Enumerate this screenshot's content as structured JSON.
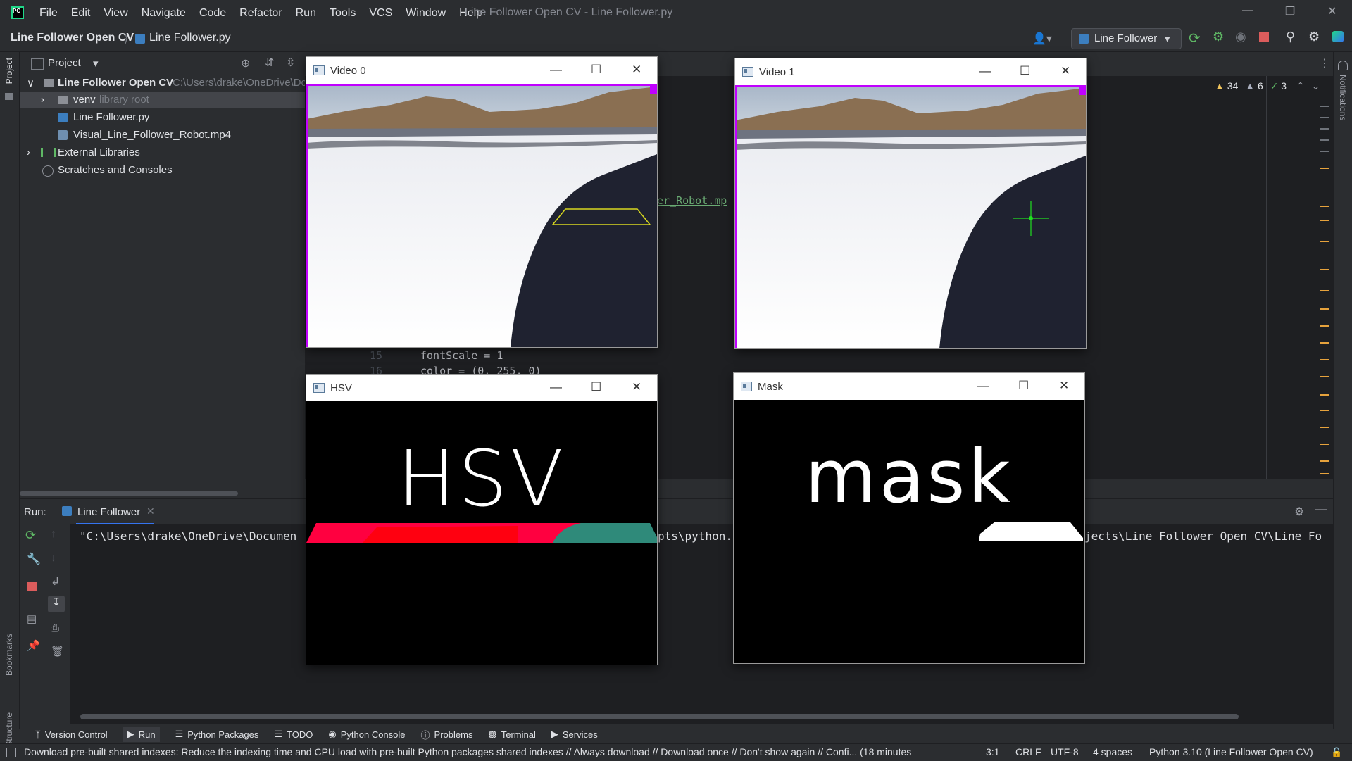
{
  "menu": [
    "File",
    "Edit",
    "View",
    "Navigate",
    "Code",
    "Refactor",
    "Run",
    "Tools",
    "VCS",
    "Window",
    "Help"
  ],
  "window_title": "Line Follower Open CV - Line Follower.py",
  "breadcrumb": {
    "project": "Line Follower Open CV",
    "file": "Line Follower.py"
  },
  "run_config": "Line Follower",
  "project_panel": {
    "title": "Project",
    "root": "Line Follower Open CV",
    "root_path": "C:\\Users\\drake\\OneDrive\\Dc",
    "items": [
      {
        "label": "venv",
        "hint": "library root"
      },
      {
        "label": "Line Follower.py"
      },
      {
        "label": "Visual_Line_Follower_Robot.mp4"
      }
    ],
    "external": "External Libraries",
    "scratches": "Scratches and Consoles"
  },
  "inspections": {
    "warnings": "34",
    "weak": "6",
    "ok": "3"
  },
  "editor": {
    "line_15_no": "15",
    "line_15_code": "fontScale = 1",
    "line_16_no": "16",
    "line_16_code": "color = (0, 255, 0)",
    "fragment": "er_Robot.mp"
  },
  "run_panel": {
    "label": "Run:",
    "tab": "Line Follower",
    "console_left": "\"C:\\Users\\drake\\OneDrive\\Documen",
    "console_mid": "pts\\python.",
    "console_right": "jects\\Line Follower Open CV\\Line Fo"
  },
  "cv_windows": [
    {
      "title": "Video 0"
    },
    {
      "title": "Video 1"
    },
    {
      "title": "HSV",
      "overlay": "HSV"
    },
    {
      "title": "Mask",
      "overlay": "mask"
    }
  ],
  "tool_windows": [
    "Version Control",
    "Run",
    "Python Packages",
    "TODO",
    "Python Console",
    "Problems",
    "Terminal",
    "Services"
  ],
  "left_strip": {
    "project": "Project",
    "bookmarks": "Bookmarks",
    "structure": "Structure"
  },
  "right_strip": {
    "notifications": "Notifications"
  },
  "status": {
    "message": "Download pre-built shared indexes: Reduce the indexing time and CPU load with pre-built Python packages shared indexes // Always download // Download once // Don't show again // Confi... (18 minutes",
    "position": "3:1",
    "line_sep": "CRLF",
    "encoding": "UTF-8",
    "indent": "4 spaces",
    "interpreter": "Python 3.10 (Line Follower Open CV)"
  },
  "colors": {
    "accent": "#3574f0",
    "run_green": "#5fb865",
    "stop_red": "#db5c5c",
    "magenta_border": "#c000ff"
  }
}
